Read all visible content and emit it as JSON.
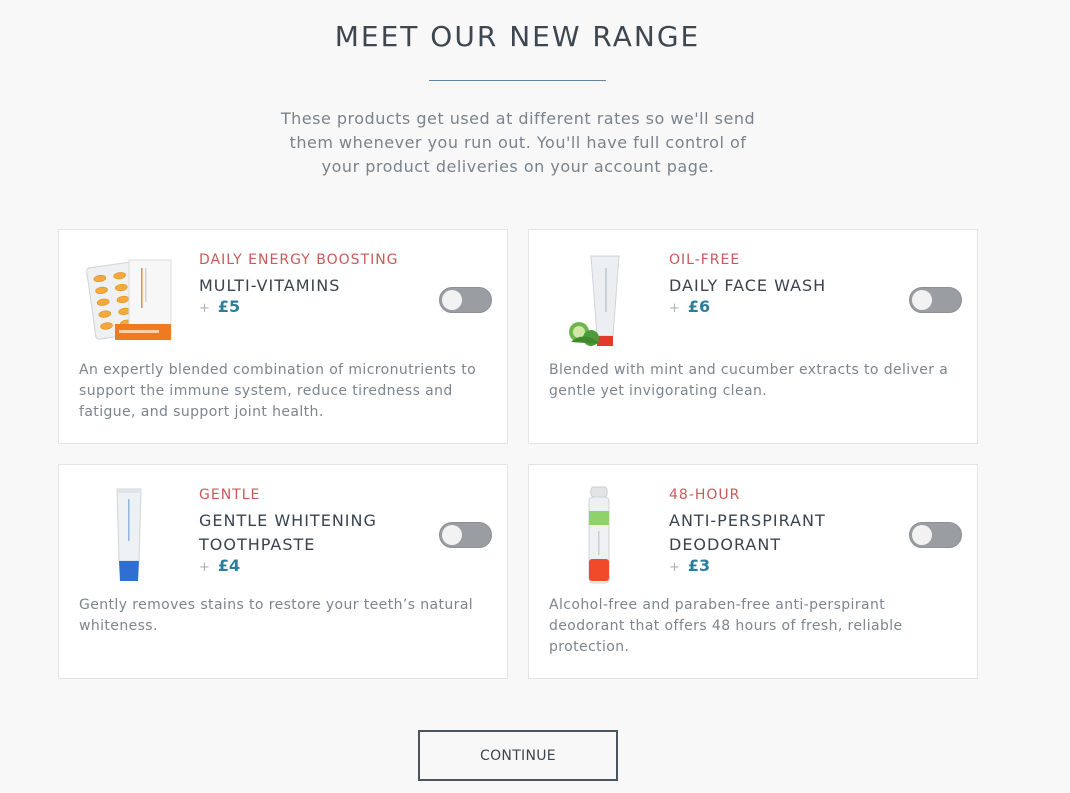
{
  "header": {
    "title": "MEET OUR NEW RANGE",
    "intro": "These products get used at different rates so we'll send them whenever you run out. You'll have full control of your product deliveries on your account page."
  },
  "products": [
    {
      "kicker": "DAILY ENERGY BOOSTING",
      "name": "MULTI-VITAMINS",
      "plus": "+",
      "price": "£5",
      "toggle_on": false,
      "description": "An expertly blended combination of micronutrients to support the immune system, reduce tiredness and fatigue, and support joint health.",
      "image": "multivitamin-blister-pack"
    },
    {
      "kicker": "OIL-FREE",
      "name": "DAILY FACE WASH",
      "plus": "+",
      "price": "£6",
      "toggle_on": false,
      "description": "Blended with mint and cucumber extracts to deliver a gentle yet invigorating clean.",
      "image": "face-wash-tube"
    },
    {
      "kicker": "GENTLE",
      "name": "GENTLE WHITENING TOOTHPASTE",
      "plus": "+",
      "price": "£4",
      "toggle_on": false,
      "description": "Gently removes stains to restore your teeth’s natural whiteness.",
      "image": "toothpaste-tube"
    },
    {
      "kicker": "48-HOUR",
      "name": "ANTI-PERSPIRANT DEODORANT",
      "plus": "+",
      "price": "£3",
      "toggle_on": false,
      "description": "Alcohol-free and paraben-free anti-perspirant deodorant that offers 48 hours of fresh, reliable protection.",
      "image": "deodorant-can"
    }
  ],
  "footer": {
    "continue_label": "CONTINUE"
  },
  "colors": {
    "accent_kicker": "#c95a58",
    "price": "#2c7f9c",
    "toggle_off": "#9a9ea3"
  }
}
